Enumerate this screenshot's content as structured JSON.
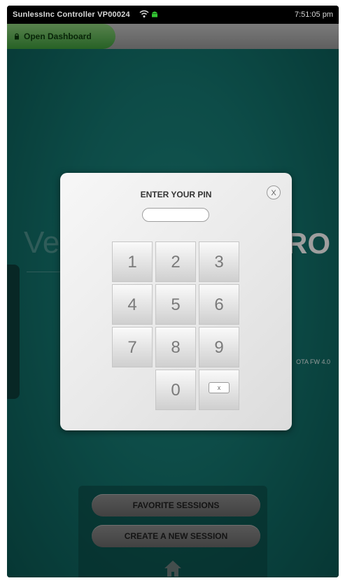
{
  "status_bar": {
    "title": "SunlessInc Controller  VP00024",
    "time": "7:51:05 pm"
  },
  "dashboard": {
    "label": "Open Dashboard"
  },
  "background": {
    "logo_left": "Ve",
    "logo_right": "RO",
    "firmware_text": "OTA FW 4.0"
  },
  "sessions": {
    "favorite_label": "FAVORITE SESSIONS",
    "create_label": "CREATE A NEW SESSION"
  },
  "pin_dialog": {
    "title": "ENTER YOUR PIN",
    "close_label": "X",
    "pin_value": "",
    "keys": [
      "1",
      "2",
      "3",
      "4",
      "5",
      "6",
      "7",
      "8",
      "9",
      "0"
    ],
    "backspace_label": "x"
  },
  "icons": {
    "wifi": "wifi-icon",
    "android": "android-icon",
    "lock": "lock-icon",
    "home": "home-icon",
    "close": "close-icon",
    "backspace": "backspace-icon"
  },
  "colors": {
    "teal_background": "#157a73",
    "dashboard_green": "#3f9e3d",
    "status_green": "#34c634"
  }
}
